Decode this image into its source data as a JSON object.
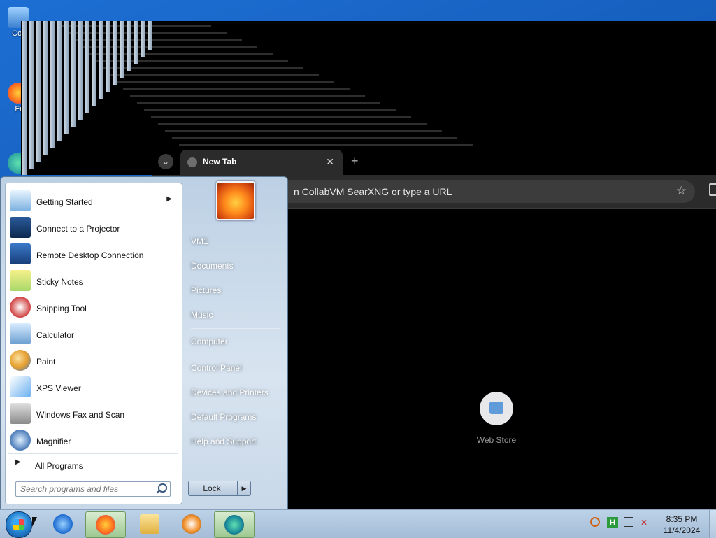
{
  "desktop": {
    "icons": [
      {
        "label": "Cor",
        "icon": "computer-icon"
      },
      {
        "label": "Fi",
        "icon": "firefox-icon"
      },
      {
        "label": "",
        "icon": "edge-icon"
      }
    ]
  },
  "browser": {
    "tab_title": "New Tab",
    "tab_close": "✕",
    "new_tab": "+",
    "tab_dropdown": "⌄",
    "omnibox_text": "n CollabVM SearXNG or type a URL",
    "bookmark_icon": "☆",
    "shortcut_label": "Web Store"
  },
  "start_menu": {
    "programs": [
      {
        "label": "Getting Started",
        "icon": "getting-started-icon",
        "has_submenu": true
      },
      {
        "label": "Connect to a Projector",
        "icon": "projector-icon"
      },
      {
        "label": "Remote Desktop Connection",
        "icon": "remote-desktop-icon"
      },
      {
        "label": "Sticky Notes",
        "icon": "sticky-notes-icon"
      },
      {
        "label": "Snipping Tool",
        "icon": "snipping-tool-icon"
      },
      {
        "label": "Calculator",
        "icon": "calculator-icon"
      },
      {
        "label": "Paint",
        "icon": "paint-icon"
      },
      {
        "label": "XPS Viewer",
        "icon": "xps-viewer-icon"
      },
      {
        "label": "Windows Fax and Scan",
        "icon": "fax-scan-icon"
      },
      {
        "label": "Magnifier",
        "icon": "magnifier-icon"
      }
    ],
    "all_programs": "All Programs",
    "search_placeholder": "Search programs and files",
    "right_items": [
      "VM1",
      "Documents",
      "Pictures",
      "Music",
      "Computer",
      "Control Panel",
      "Devices and Printers",
      "Default Programs",
      "Help and Support"
    ],
    "lock_label": "Lock",
    "lock_arrow": "▶"
  },
  "taskbar": {
    "apps": [
      "internet-explorer-icon",
      "firefox-icon",
      "explorer-icon",
      "media-player-icon",
      "edge-icon"
    ],
    "clock_time": "8:35 PM",
    "clock_date": "11/4/2024"
  },
  "colors": {
    "accent": "#1c5fb8",
    "browser_bg": "#000000",
    "start_menu_bg": "#c8d8e8"
  }
}
